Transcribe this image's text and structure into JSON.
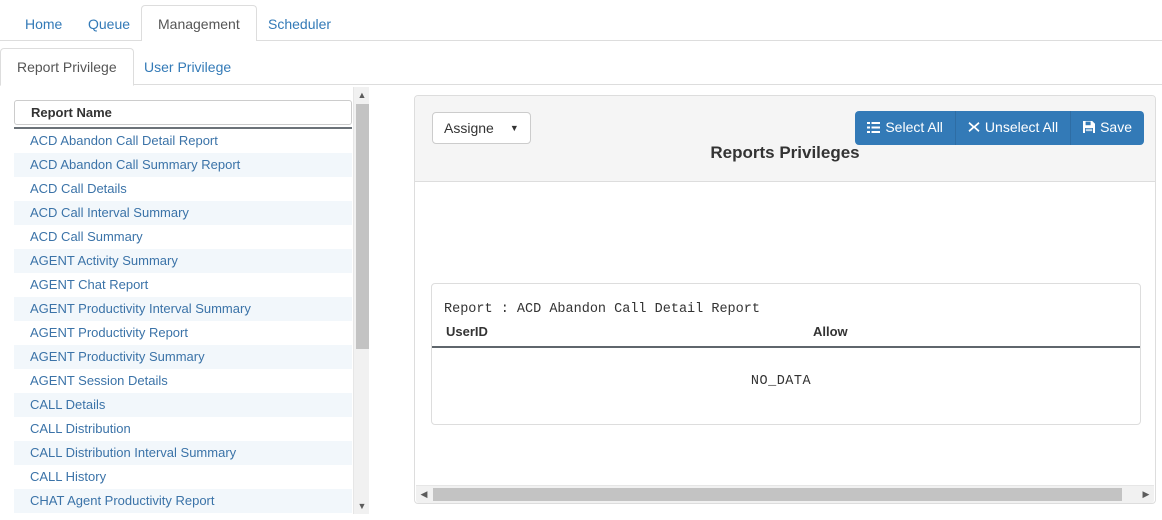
{
  "primary_tabs": [
    {
      "label": "Home",
      "active": false
    },
    {
      "label": "Queue",
      "active": false
    },
    {
      "label": "Management",
      "active": true
    },
    {
      "label": "Scheduler",
      "active": false
    }
  ],
  "secondary_tabs": [
    {
      "label": "Report Privilege",
      "active": true
    },
    {
      "label": "User Privilege",
      "active": false
    }
  ],
  "report_list": {
    "header": "Report Name",
    "items": [
      "ACD Abandon Call Detail Report",
      "ACD Abandon Call Summary Report",
      "ACD Call Details",
      "ACD Call Interval Summary",
      "ACD Call Summary",
      "AGENT Activity Summary",
      "AGENT Chat Report",
      "AGENT Productivity Interval Summary",
      "AGENT Productivity Report",
      "AGENT Productivity Summary",
      "AGENT Session Details",
      "CALL Details",
      "CALL Distribution",
      "CALL Distribution Interval Summary",
      "CALL History",
      "CHAT Agent Productivity Report"
    ]
  },
  "toolbar": {
    "assigne_label": "Assigne",
    "assigne_caret": "▼",
    "select_all_label": "Select All",
    "select_all_icon": "list-icon",
    "unselect_all_label": "Unselect All",
    "unselect_all_icon": "close-x-icon",
    "save_label": "Save",
    "save_icon": "floppy-disk-icon"
  },
  "panel": {
    "title": "Reports Privileges"
  },
  "result": {
    "report_line": "Report : ACD Abandon Call Detail Report",
    "col_userid": "UserID",
    "col_allow": "Allow",
    "empty_text": "NO_DATA"
  },
  "scrollbars": {
    "v_up": "▲",
    "v_down": "▼",
    "h_left": "◀",
    "h_right": "▶"
  },
  "colors": {
    "link": "#337ab7",
    "primary_button": "#337ab7",
    "row_alt": "#f2f7fb",
    "panel_heading": "#f5f5f5"
  }
}
